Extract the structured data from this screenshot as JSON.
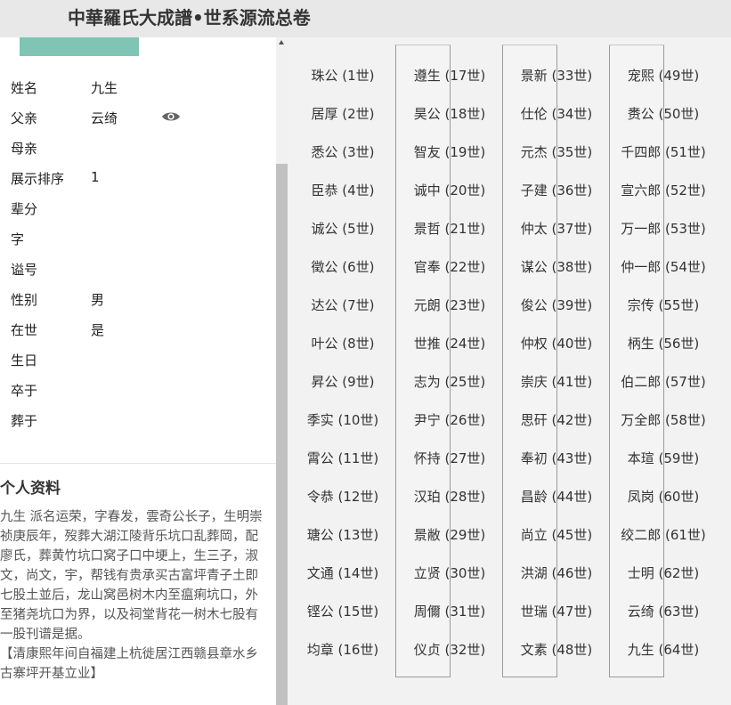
{
  "header": {
    "title": "中華羅氏大成譜•世系源流总卷"
  },
  "profile": {
    "rows": [
      {
        "label": "姓名",
        "value": "九生"
      },
      {
        "label": "父亲",
        "value": "云绮"
      },
      {
        "label": "母亲",
        "value": ""
      },
      {
        "label": "展示排序",
        "value": "1"
      },
      {
        "label": "辈分",
        "value": ""
      },
      {
        "label": "字",
        "value": ""
      },
      {
        "label": "谥号",
        "value": ""
      },
      {
        "label": "性别",
        "value": "男"
      },
      {
        "label": "在世",
        "value": "是"
      },
      {
        "label": "生日",
        "value": ""
      },
      {
        "label": "卒于",
        "value": ""
      },
      {
        "label": "葬于",
        "value": ""
      }
    ],
    "eye_icon": "eye-icon"
  },
  "info": {
    "title": "个人资料",
    "text": "九生 派名运荣，字春发，雲奇公长子，生明崇祯庚辰年，歿葬大湖江陵背乐坑口乱葬岡，配廖氏，葬黄竹坑口窝子口中埂上，生三子，淑文，尚文，宇，帮钱有贵承买古富坪青子土即七股土並后，龙山窝邑树木内至瘟痢坑口，外至猪尧坑口为界，以及祠堂背花一树木七股有一股刊谱是据。",
    "note": "【清康熙年间自福建上杭徙居江西赣县章水乡古寨坪开基立业】"
  },
  "generations": [
    "珠公 (1世)",
    "居厚 (2世)",
    "悉公 (3世)",
    "臣恭 (4世)",
    "诚公 (5世)",
    "徵公 (6世)",
    "达公 (7世)",
    "叶公 (8世)",
    "昇公 (9世)",
    "季实 (10世)",
    "霄公 (11世)",
    "令恭 (12世)",
    "瑭公 (13世)",
    "文通 (14世)",
    "铿公 (15世)",
    "均章 (16世)",
    "遵生 (17世)",
    "昊公 (18世)",
    "智友 (19世)",
    "诚中 (20世)",
    "景哲 (21世)",
    "官奉 (22世)",
    "元朗 (23世)",
    "世推 (24世)",
    "志为 (25世)",
    "尹宁 (26世)",
    "怀持 (27世)",
    "汉珀 (28世)",
    "景敝 (29世)",
    "立贤 (30世)",
    "周儞 (31世)",
    "仪贞 (32世)",
    "景新 (33世)",
    "仕伦 (34世)",
    "元杰 (35世)",
    "子建 (36世)",
    "仲太 (37世)",
    "谋公 (38世)",
    "俊公 (39世)",
    "仲权 (40世)",
    "崇庆 (41世)",
    "思矸 (42世)",
    "奉初 (43世)",
    "昌龄 (44世)",
    "尚立 (45世)",
    "洪湖 (46世)",
    "世瑞 (47世)",
    "文素 (48世)",
    "宠熙 (49世)",
    "赉公 (50世)",
    "千四郎 (51世)",
    "宣六郎 (52世)",
    "万一郎 (53世)",
    "仲一郎 (54世)",
    "宗传 (55世)",
    "柄生 (56世)",
    "伯二郎 (57世)",
    "万全郎 (58世)",
    "本瑄 (59世)",
    "凤岗 (60世)",
    "绞二郎 (61世)",
    "士明 (62世)",
    "云绮 (63世)",
    "九生 (64世)"
  ]
}
